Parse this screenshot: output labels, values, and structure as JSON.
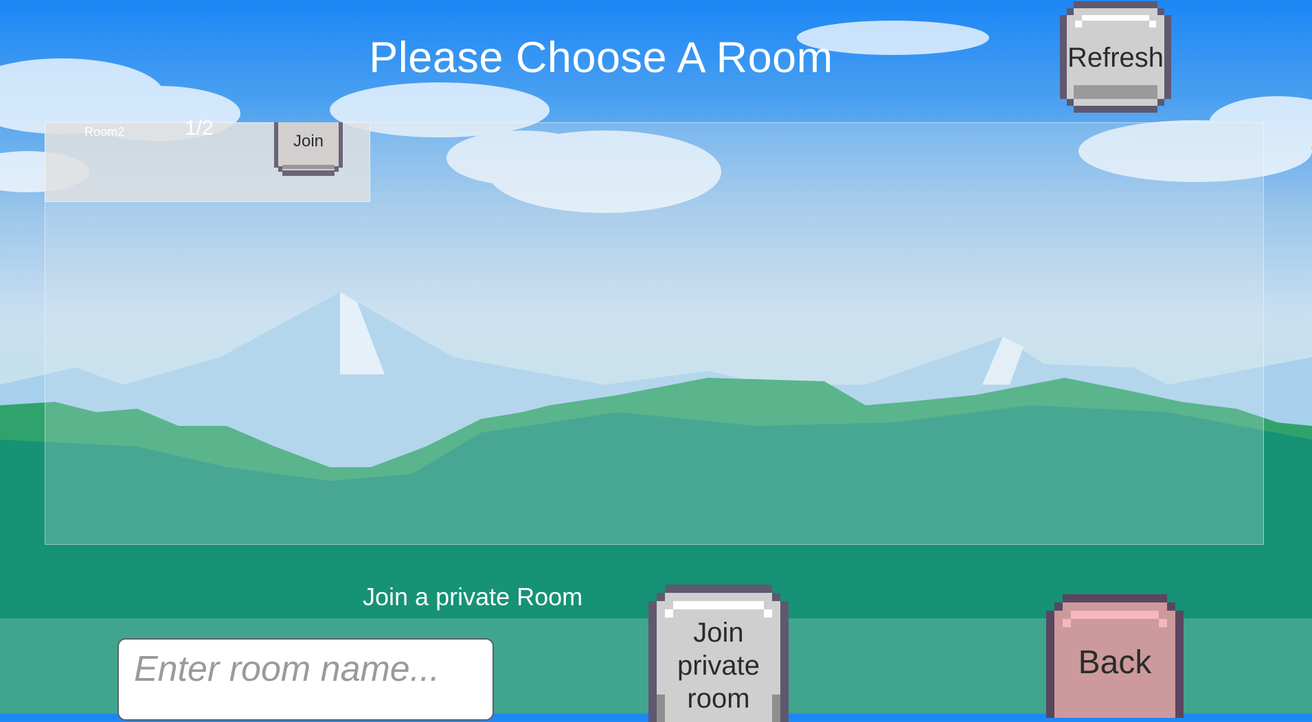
{
  "header": {
    "title": "Please Choose A Room",
    "refresh_label": "Refresh"
  },
  "rooms": [
    {
      "name": "Room2",
      "players": "1/2",
      "join_label": "Join"
    }
  ],
  "private_room": {
    "label": "Join a private Room",
    "input_placeholder": "Enter room name...",
    "input_value": "",
    "join_label_lines": [
      "Join",
      "private",
      "room"
    ]
  },
  "footer": {
    "back_label": "Back"
  },
  "colors": {
    "sky_top": "#1c86f6",
    "grass": "#139479",
    "button_gray": "#d0d0d0",
    "button_border": "#5f5870",
    "back_button": "#cc9a9c",
    "text_white": "#ffffff"
  }
}
